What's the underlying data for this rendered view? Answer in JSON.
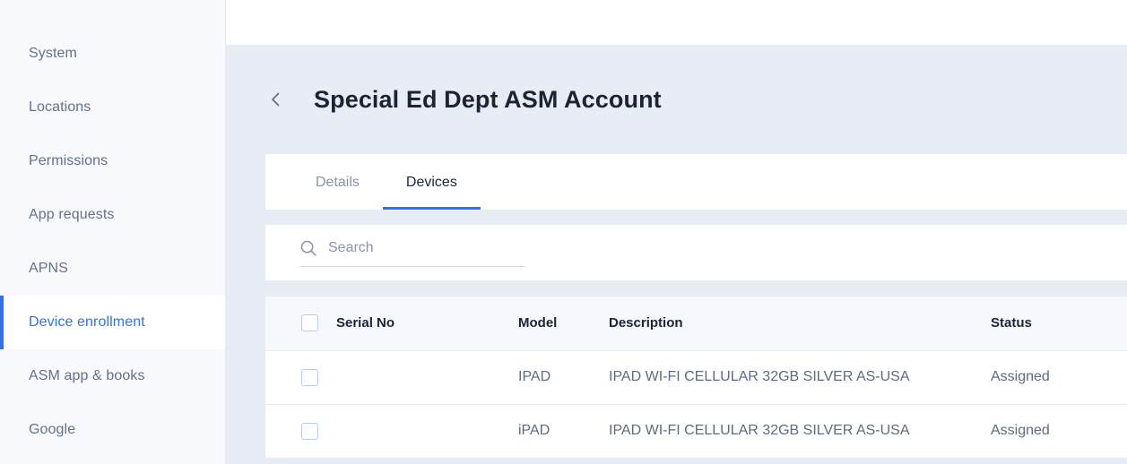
{
  "sidebar": {
    "items": [
      {
        "label": "System",
        "active": false
      },
      {
        "label": "Locations",
        "active": false
      },
      {
        "label": "Permissions",
        "active": false
      },
      {
        "label": "App requests",
        "active": false
      },
      {
        "label": "APNS",
        "active": false
      },
      {
        "label": "Device enrollment",
        "active": true
      },
      {
        "label": "ASM app & books",
        "active": false
      },
      {
        "label": "Google",
        "active": false
      }
    ],
    "active_color": "#2f72ee",
    "text_color": "#63718a"
  },
  "header": {
    "back_icon": "chevron-left-icon",
    "title": "Special Ed Dept ASM Account"
  },
  "tabs": [
    {
      "label": "Details",
      "active": false
    },
    {
      "label": "Devices",
      "active": true
    }
  ],
  "search": {
    "icon": "search-icon",
    "placeholder": "Search",
    "value": ""
  },
  "table": {
    "select_all_checkbox": "checkbox-unchecked",
    "columns": [
      "Serial No",
      "Model",
      "Description",
      "Status"
    ],
    "rows": [
      {
        "checkbox": "checkbox-unchecked",
        "serial": "",
        "serial_redacted": true,
        "model": "IPAD",
        "description": "IPAD WI-FI CELLULAR 32GB SILVER AS-USA",
        "status": "Assigned"
      },
      {
        "checkbox": "checkbox-unchecked",
        "serial": "",
        "serial_redacted": true,
        "model": "iPAD",
        "description": "IPAD WI-FI CELLULAR 32GB SILVER AS-USA",
        "status": "Assigned"
      }
    ]
  },
  "colors": {
    "accent": "#2f72ee",
    "page_background": "#e8ecf5",
    "sidebar_background": "#f7f9fc",
    "card_background": "#ffffff",
    "table_header_background": "#f5f8fd"
  }
}
